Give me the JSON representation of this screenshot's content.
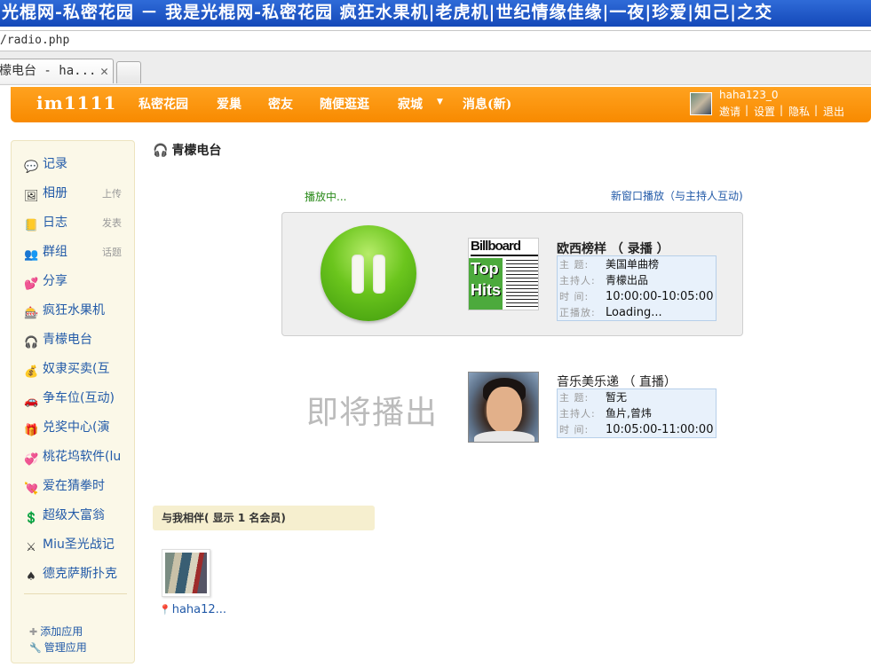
{
  "browser": {
    "title": "光棍网-私密花园 － 我是光棍网-私密花园 疯狂水果机|老虎机|世纪情缘佳缘|一夜|珍爱|知己|之交",
    "address": "/radio.php",
    "tab_label": "檬电台 - ha...",
    "tab_close": "✕"
  },
  "header": {
    "logo": "im1111",
    "nav": [
      "私密花园",
      "爱巢",
      "密友",
      "随便逛逛",
      "寂城",
      "消息(新)"
    ],
    "dropdown_arrow": "▼",
    "username": "haha123_0",
    "links": [
      "邀请",
      "设置",
      "隐私",
      "退出"
    ],
    "separator": "|"
  },
  "sidebar": {
    "items": [
      {
        "label": "记录",
        "sub": "",
        "icon": "chat-bubble-icon",
        "glyph": "💬"
      },
      {
        "label": "相册",
        "sub": "上传",
        "icon": "photo-icon",
        "glyph": "🖼"
      },
      {
        "label": "日志",
        "sub": "发表",
        "icon": "notebook-icon",
        "glyph": "📒"
      },
      {
        "label": "群组",
        "sub": "话题",
        "icon": "group-icon",
        "glyph": "👥"
      },
      {
        "label": "分享",
        "sub": "",
        "icon": "heart-share-icon",
        "glyph": "💕"
      },
      {
        "label": "疯狂水果机",
        "sub": "",
        "icon": "slot-machine-icon",
        "glyph": "🎰"
      },
      {
        "label": "青檬电台",
        "sub": "",
        "icon": "headphones-icon",
        "glyph": "🎧"
      },
      {
        "label": "奴隶买卖(互",
        "sub": "",
        "icon": "coins-icon",
        "glyph": "💰"
      },
      {
        "label": "争车位(互动)",
        "sub": "",
        "icon": "car-icon",
        "glyph": "🚗"
      },
      {
        "label": "兑奖中心(演",
        "sub": "",
        "icon": "gift-icon",
        "glyph": "🎁"
      },
      {
        "label": "桃花坞软件(lu",
        "sub": "",
        "icon": "hearts-icon",
        "glyph": "💞"
      },
      {
        "label": "爱在猜拳时",
        "sub": "",
        "icon": "heart-fist-icon",
        "glyph": "💘"
      },
      {
        "label": "超级大富翁",
        "sub": "",
        "icon": "money-icon",
        "glyph": "💲"
      },
      {
        "label": "Miu圣光战记",
        "sub": "",
        "icon": "sword-icon",
        "glyph": "⚔"
      },
      {
        "label": "德克萨斯扑克",
        "sub": "",
        "icon": "spade-icon",
        "glyph": "♠"
      }
    ],
    "add_app": "添加应用",
    "manage_app": "管理应用"
  },
  "main": {
    "title": "青檬电台",
    "playing": "播放中...",
    "new_window": "新窗口播放（与主持人互动)",
    "current": {
      "title": "欧西榜样 （ 录播 ）",
      "cover_text_1": "Billboard",
      "cover_text_2": "Top Hits",
      "rows": [
        {
          "k": "主  题:",
          "v": "美国单曲榜"
        },
        {
          "k": "主持人:",
          "v": "青檬出品"
        },
        {
          "k": "时  间:",
          "v": "10:00:00-10:05:00"
        },
        {
          "k": "正播放:",
          "v": "Loading..."
        }
      ]
    },
    "upcoming_label": "即将播出",
    "next": {
      "title": "音乐美乐递 （ 直播）",
      "rows": [
        {
          "k": "主  题:",
          "v": "暂无"
        },
        {
          "k": "主持人:",
          "v": "鱼片,曾炜"
        },
        {
          "k": "时  间:",
          "v": "10:05:00-11:00:00"
        }
      ]
    },
    "companions_title": "与我相伴( 显示 1 名会员)",
    "member_name": "haha12..."
  },
  "colors": {
    "header_orange": "#f88a00",
    "link_blue": "#225aa8",
    "play_green": "#6bc51d"
  }
}
